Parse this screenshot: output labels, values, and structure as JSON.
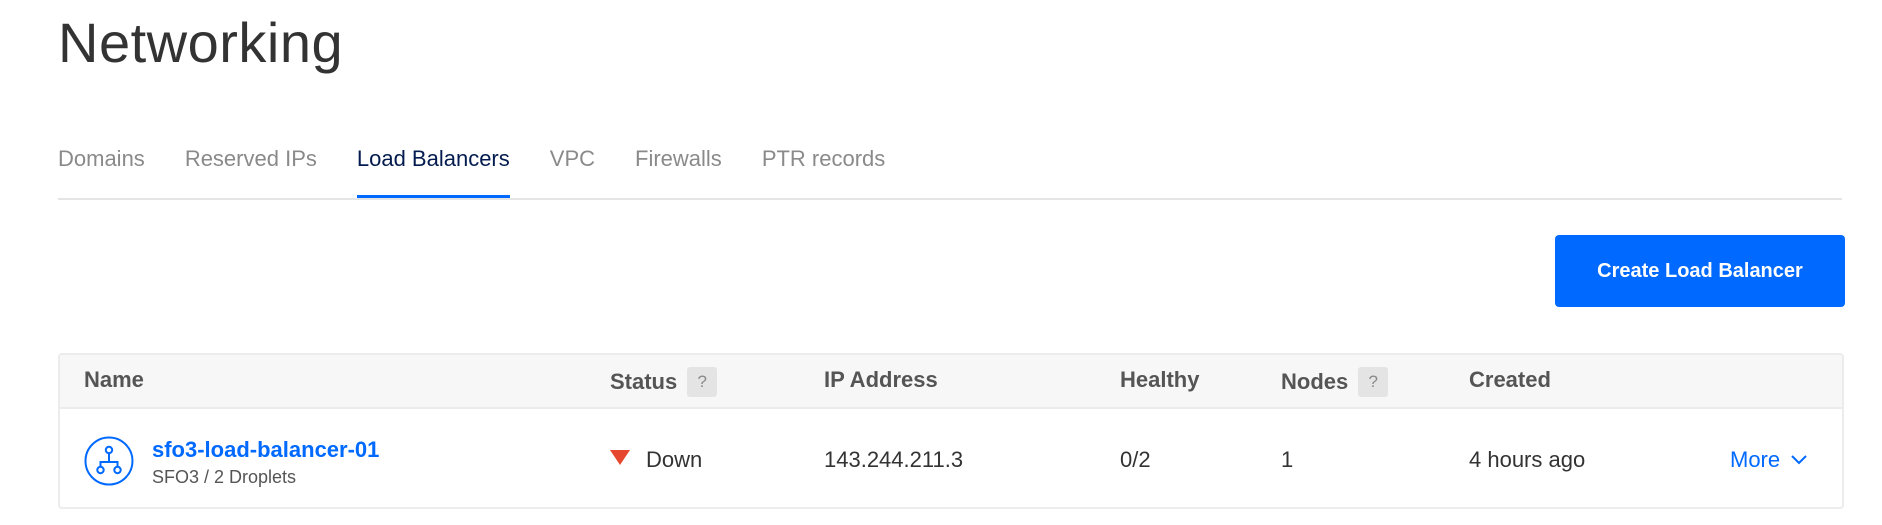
{
  "page": {
    "title": "Networking"
  },
  "tabs": [
    {
      "label": "Domains",
      "active": false
    },
    {
      "label": "Reserved IPs",
      "active": false
    },
    {
      "label": "Load Balancers",
      "active": true
    },
    {
      "label": "VPC",
      "active": false
    },
    {
      "label": "Firewalls",
      "active": false
    },
    {
      "label": "PTR records",
      "active": false
    }
  ],
  "actions": {
    "create_label": "Create Load Balancer"
  },
  "table": {
    "columns": {
      "name": "Name",
      "status": "Status",
      "status_help": "?",
      "ip": "IP Address",
      "healthy": "Healthy",
      "nodes": "Nodes",
      "nodes_help": "?",
      "created": "Created"
    },
    "rows": [
      {
        "icon": "load-balancer-icon",
        "name": "sfo3-load-balancer-01",
        "subtitle": "SFO3 / 2 Droplets",
        "status": "Down",
        "ip": "143.244.211.3",
        "healthy": "0/2",
        "nodes": "1",
        "created": "4 hours ago",
        "more_label": "More"
      }
    ]
  },
  "colors": {
    "accent": "#0069ff",
    "status_down": "#e5482e",
    "active_tab_text": "#031b4e"
  }
}
